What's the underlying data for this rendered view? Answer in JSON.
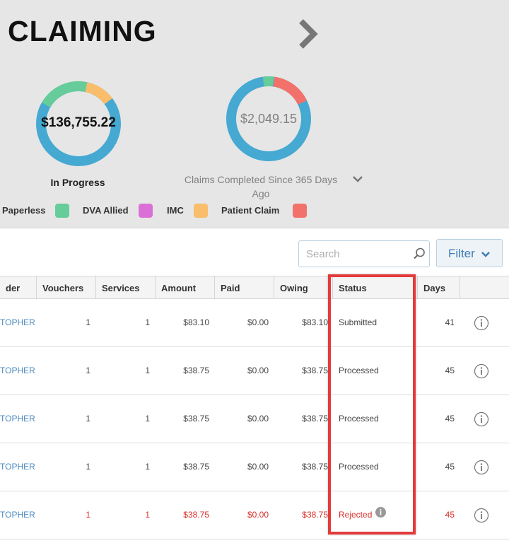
{
  "page": {
    "title": "CLAIMING"
  },
  "summary": {
    "in_progress": {
      "amount": "$136,755.22",
      "label": "In Progress"
    },
    "completed": {
      "amount": "$2,049.15",
      "label": "Claims Completed Since 365 Days Ago"
    }
  },
  "legend": [
    {
      "label": "Paperless",
      "color": "#66cc99"
    },
    {
      "label": "DVA Allied",
      "color": "#da70d6"
    },
    {
      "label": "IMC",
      "color": "#f9bd6c"
    },
    {
      "label": "Patient Claim",
      "color": "#f2726b"
    }
  ],
  "colors": {
    "bulk_bill": "#45a9d2",
    "accent": "#3d7cb5",
    "rejected": "#d9302b",
    "highlight": "#e43a3a"
  },
  "search": {
    "placeholder": "Search",
    "value": ""
  },
  "filter": {
    "label": "Filter"
  },
  "table": {
    "columns": [
      "der",
      "Vouchers",
      "Services",
      "Amount",
      "Paid",
      "Owing",
      "Status",
      "Days"
    ],
    "rows": [
      {
        "provider": "TOPHER",
        "vouchers": "1",
        "services": "1",
        "amount": "$83.10",
        "paid": "$0.00",
        "owing": "$83.10",
        "status": "Submitted",
        "days": "41"
      },
      {
        "provider": "TOPHER",
        "vouchers": "1",
        "services": "1",
        "amount": "$38.75",
        "paid": "$0.00",
        "owing": "$38.75",
        "status": "Processed",
        "days": "45"
      },
      {
        "provider": "TOPHER",
        "vouchers": "1",
        "services": "1",
        "amount": "$38.75",
        "paid": "$0.00",
        "owing": "$38.75",
        "status": "Processed",
        "days": "45"
      },
      {
        "provider": "TOPHER",
        "vouchers": "1",
        "services": "1",
        "amount": "$38.75",
        "paid": "$0.00",
        "owing": "$38.75",
        "status": "Processed",
        "days": "45"
      },
      {
        "provider": "TOPHER",
        "vouchers": "1",
        "services": "1",
        "amount": "$38.75",
        "paid": "$0.00",
        "owing": "$38.75",
        "status": "Rejected",
        "days": "45",
        "rejected": true
      }
    ]
  }
}
